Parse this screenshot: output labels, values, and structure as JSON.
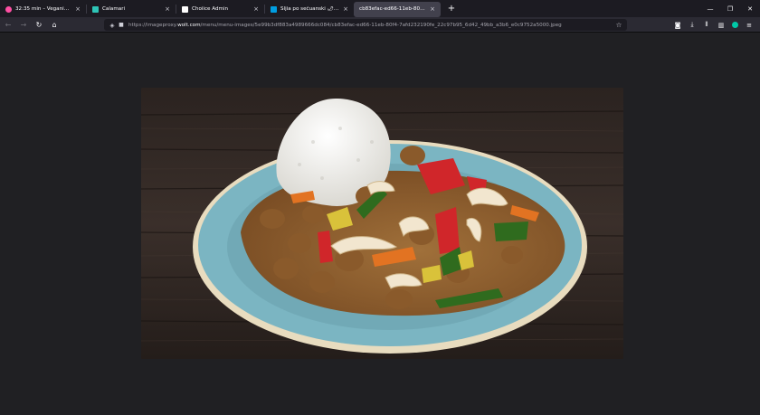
{
  "tabs": [
    {
      "title": "32:35 min – Veganio, Veganio – ",
      "favicon_color": "#ff4fa3",
      "active": false
    },
    {
      "title": "Calamari",
      "favicon_color": "#2ec4b6",
      "active": false
    },
    {
      "title": "Choiice Admin",
      "favicon_color": "#ffffff",
      "active": false
    },
    {
      "title": "Sljia po sečuanski 🌶🌶🌶 (1…",
      "favicon_color": "#009de0",
      "active": false
    },
    {
      "title": "cb83efac-ed66-11eb-80f4-7afd22…",
      "favicon_color": "",
      "active": true
    }
  ],
  "nav": {
    "url_host": "https://imageproxy.",
    "url_domain": "wolt.com",
    "url_path": "/menu/menu-images/5e99b3df883a4989666dc084/cb83efac-ed66-11eb-80f4-7afd232190fe_22c97b95_6d42_49bb_a3b6_e0c9752a5000.jpeg"
  },
  "icons": {
    "back": "←",
    "forward": "→",
    "reload": "↻",
    "home": "⌂",
    "shield": "◈",
    "lock": "🔒",
    "star": "☆",
    "pocket": "◙",
    "download": "⤓",
    "library": "⫴",
    "sidebar": "▥",
    "menu": "≡",
    "close": "×",
    "newtab": "+",
    "minimize": "—",
    "restore": "❐",
    "winclose": "✕"
  },
  "colors": {
    "chrome_bg": "#1c1b22",
    "toolbar_bg": "#2b2a33",
    "viewer_bg": "#202023",
    "plate": "#7bb5c2",
    "curry": "#8a5a2b"
  }
}
